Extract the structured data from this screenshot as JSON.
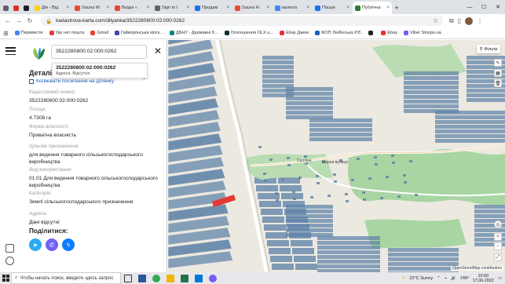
{
  "browser": {
    "tabs": [
      {
        "label": "",
        "color": "#5f6368",
        "small": true
      },
      {
        "label": "",
        "color": "#d93025",
        "small": true
      },
      {
        "label": "",
        "color": "#202124",
        "small": true
      },
      {
        "label": "Дія - Від",
        "color": "#ffd400"
      },
      {
        "label": "Sauna W",
        "color": "#e74c3c"
      },
      {
        "label": "Вхідні «",
        "color": "#ea4335"
      },
      {
        "label": "Sign in t",
        "color": "#5f6368"
      },
      {
        "label": "Продам",
        "color": "#1a73e8"
      },
      {
        "label": "Sauna Fr",
        "color": "#e74c3c"
      },
      {
        "label": "валюта",
        "color": "#4285f4"
      },
      {
        "label": "Пошук",
        "color": "#1a73e8"
      },
      {
        "label": "Публічна",
        "color": "#2e7d32",
        "active": true
      }
    ],
    "new_tab_label": "+",
    "url": "kadastrova-karta.com/dilyanka/3522280800:02:000:0262",
    "bookmarks": [
      {
        "label": "Перевести",
        "color": "#4285f4"
      },
      {
        "label": "Укр нет пошта",
        "color": "#e53935"
      },
      {
        "label": "Gmail",
        "color": "#ea4335"
      },
      {
        "label": "Гайворонська кіоск...",
        "color": "#3949ab"
      },
      {
        "label": "ДБНУ - Державні б...",
        "color": "#00897b"
      },
      {
        "label": "Оголошення OLX.u...",
        "color": "#002f34"
      },
      {
        "label": "Ebay Джем",
        "color": "#e53238"
      },
      {
        "label": "ФОП Любінська Р.Є.",
        "color": "#1565c0"
      },
      {
        "label": "",
        "color": "#222"
      },
      {
        "label": "Ebay",
        "color": "#e53238"
      },
      {
        "label": "Viber Stoops.ua",
        "color": "#7360f2"
      }
    ]
  },
  "sidebar": {
    "search_value": "3522280800:02:000:0262",
    "dropdown": {
      "number": "3522280800:02:000:0262",
      "address": "Адреса: Відсутня"
    },
    "details_title": "Деталі д",
    "copy_link": "Копіювати посилання на ділянку",
    "fields": [
      {
        "label": "Кадастровий номер:",
        "value": "3522280800:02:000:0262"
      },
      {
        "label": "Площа:",
        "value": "4.7308 га"
      },
      {
        "label": "Форма власності:",
        "value": "Приватна власність"
      },
      {
        "label": "Цільове призначення:",
        "value": "для ведення товарного сільськогосподарського виробництва"
      },
      {
        "label": "Вид використання:",
        "value": "01.01 Для ведення товарного сільськогосподарського виробництва"
      },
      {
        "label": "Категорія:",
        "value": "Землі сільськогосподарського призначення"
      },
      {
        "label": "Адреса:",
        "value": "Дані відсутні"
      }
    ],
    "share_title": "Поділитися:",
    "share_colors": {
      "telegram": "#2aabee",
      "viber": "#7360f2",
      "messenger": "#0a7cff"
    }
  },
  "map": {
    "filter_label": "Фільтр",
    "attribution": "OpenStreetMap contributors",
    "village_label": "Сабліне",
    "street_label": "Мирна вулиця",
    "highlight_color": "#e53935",
    "parcel_color": "#5b7fa6",
    "forest_color": "#a8d5a2"
  },
  "taskbar": {
    "search_placeholder": "Чтобы начать поиск, введите здесь запрос",
    "weather": "22°C Sunny",
    "lang": "УКР",
    "time": "10:00",
    "date": "17.06.2022"
  }
}
